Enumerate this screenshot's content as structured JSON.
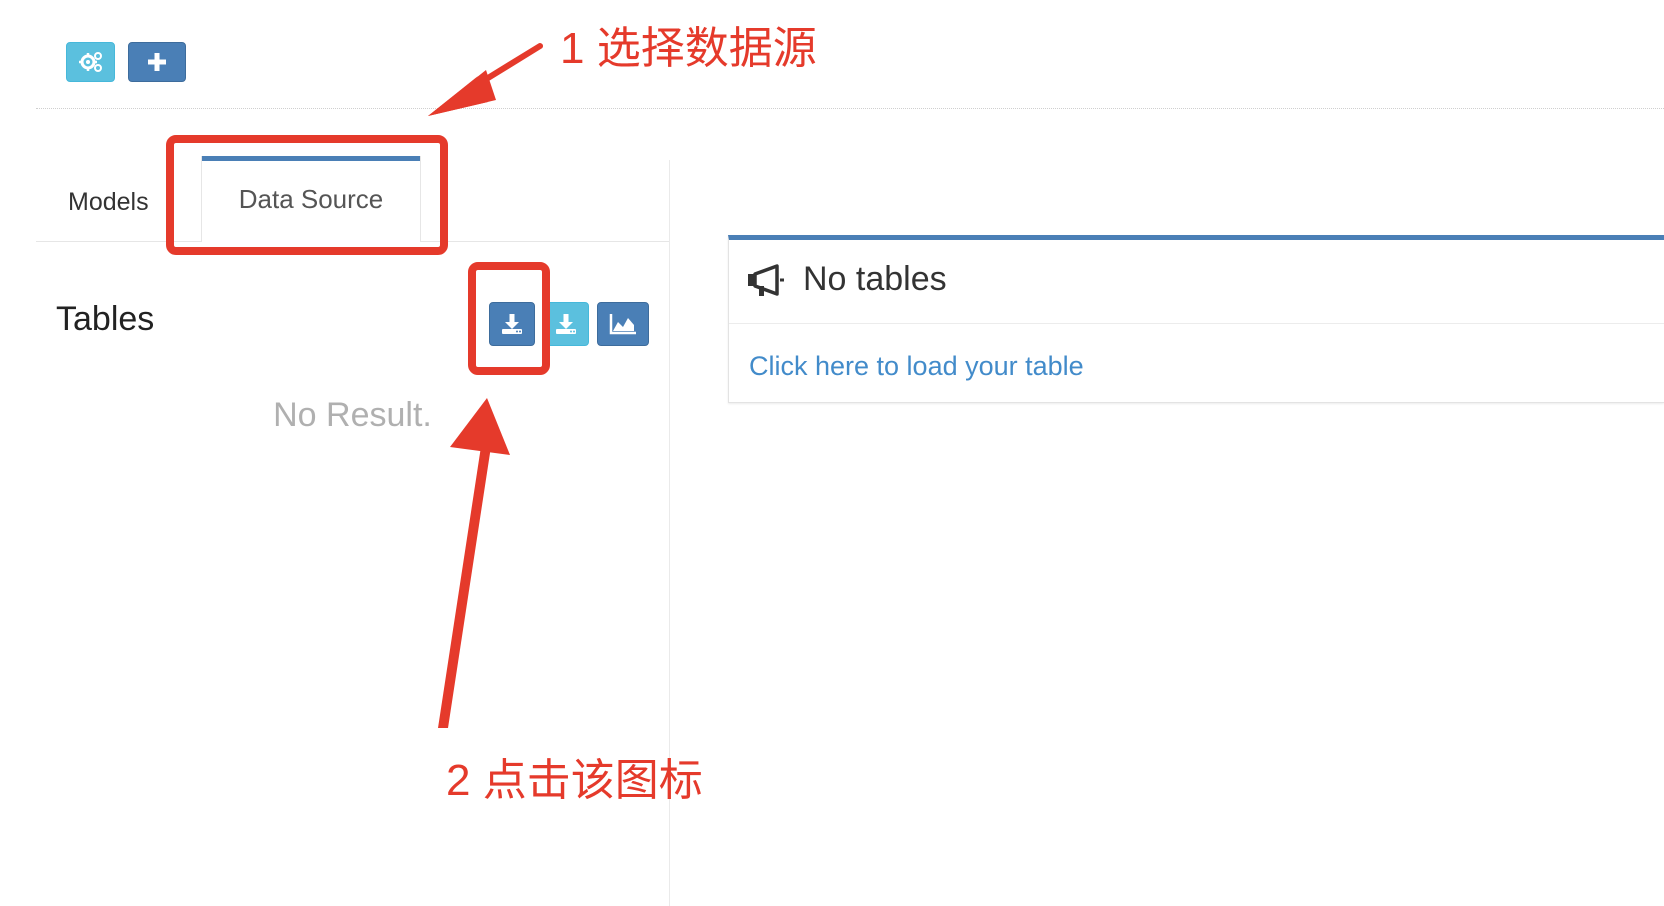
{
  "toolbar": {
    "settings_icon": "gears-icon",
    "add_icon": "plus-icon",
    "colors": {
      "info": "#5bc0de",
      "primary": "#4a7fb6"
    }
  },
  "tabs": [
    {
      "label": "Models",
      "active": false
    },
    {
      "label": "Data Source",
      "active": true
    }
  ],
  "tables_panel": {
    "title": "Tables",
    "buttons": [
      {
        "icon": "download-icon",
        "color": "#4a7fb6"
      },
      {
        "icon": "download-icon",
        "color": "#5bc0de"
      },
      {
        "icon": "area-chart-icon",
        "color": "#4a7fb6"
      }
    ],
    "empty_text": "No Result."
  },
  "notice_box": {
    "icon": "megaphone-icon",
    "title": "No tables",
    "link_text": "Click here to load your table",
    "accent_color": "#4a7fb6",
    "link_color": "#428bca"
  },
  "annotations": {
    "step1": "1  选择数据源",
    "step2": "2 点击该图标",
    "color": "#e53a2b"
  }
}
